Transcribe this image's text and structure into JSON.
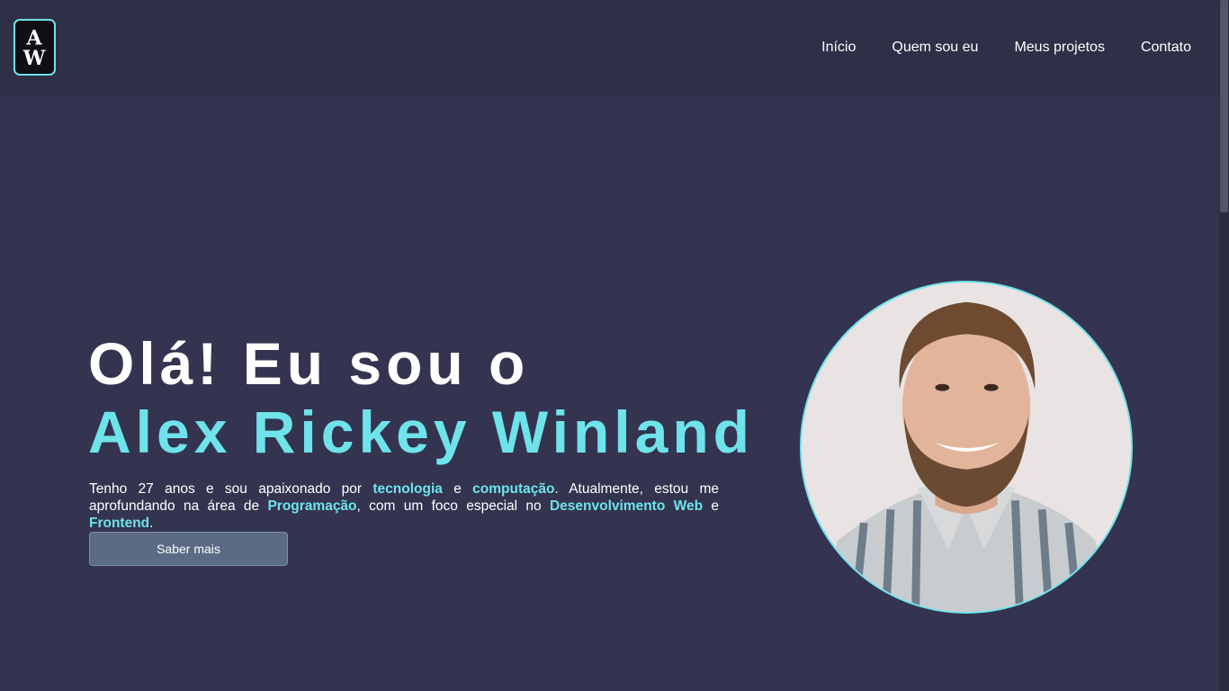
{
  "header": {
    "logo_text": "AW",
    "nav": [
      {
        "label": "Início"
      },
      {
        "label": "Quem sou eu"
      },
      {
        "label": "Meus projetos"
      },
      {
        "label": "Contato"
      }
    ]
  },
  "hero": {
    "greeting": "Olá! Eu sou o",
    "name": "Alex Rickey Winland",
    "intro": {
      "part1": "Tenho 27 anos e sou apaixonado por ",
      "hl1": "tecnologia",
      "part2": " e ",
      "hl2": "computação",
      "part3": ". Atualmente, estou me aprofundando na área de ",
      "hl3": "Programação",
      "part4": ", com um foco especial no ",
      "hl4": "Desenvolvimento Web",
      "part5": " e ",
      "hl5": "Frontend",
      "part6": "."
    },
    "button_label": "Saber mais"
  },
  "colors": {
    "background": "#343450",
    "header": "#2f2f47",
    "accent": "#6ee3ea",
    "button": "#5b6b85"
  }
}
